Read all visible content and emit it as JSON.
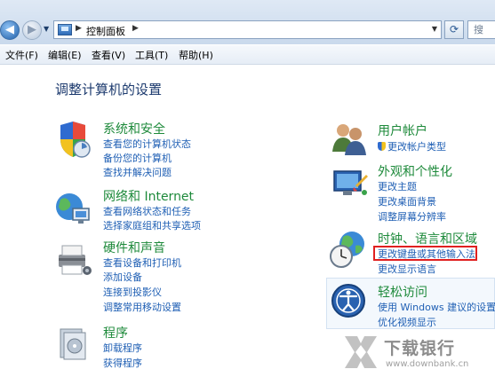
{
  "address_bar": {
    "breadcrumb": "控制面板",
    "search_glyph": "搜"
  },
  "menu": [
    "文件(F)",
    "编辑(E)",
    "查看(V)",
    "工具(T)",
    "帮助(H)"
  ],
  "page_title": "调整计算机的设置",
  "categories": [
    {
      "title": "系统和安全",
      "links": [
        "查看您的计算机状态",
        "备份您的计算机",
        "查找并解决问题"
      ]
    },
    {
      "title": "网络和 Internet",
      "links": [
        "查看网络状态和任务",
        "选择家庭组和共享选项"
      ]
    },
    {
      "title": "硬件和声音",
      "links": [
        "查看设备和打印机",
        "添加设备",
        "连接到投影仪",
        "调整常用移动设置"
      ]
    },
    {
      "title": "程序",
      "links": [
        "卸载程序",
        "获得程序"
      ]
    },
    {
      "title": "用户帐户",
      "links": [
        "更改帐户类型"
      ]
    },
    {
      "title": "外观和个性化",
      "links": [
        "更改主题",
        "更改桌面背景",
        "调整屏幕分辨率"
      ]
    },
    {
      "title": "时钟、语言和区域",
      "links": [
        "更改键盘或其他输入法",
        "更改显示语言"
      ]
    },
    {
      "title": "轻松访问",
      "links": [
        "使用 Windows 建议的设置",
        "优化视频显示"
      ]
    }
  ],
  "watermark": {
    "name": "下载银行",
    "url": "www.downbank.cn"
  },
  "colors": {
    "category_title": "#1e8a3b",
    "link": "#1f5fb4",
    "highlight": "#e02020"
  }
}
